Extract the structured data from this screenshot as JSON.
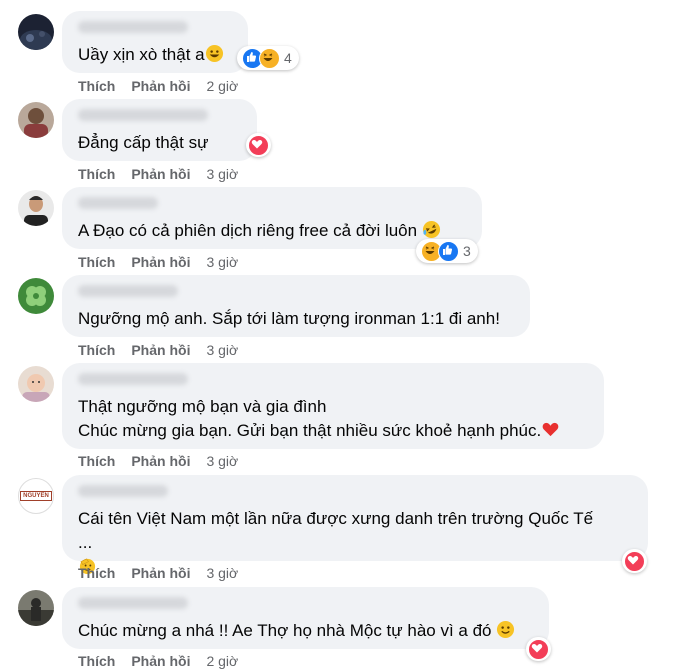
{
  "colors": {
    "bubble": "#f0f2f5",
    "meta": "#65676b",
    "like": "#1877f2",
    "love": "#f33e58",
    "haha": "#f7b125"
  },
  "labels": {
    "like": "Thích",
    "reply": "Phản hồi"
  },
  "comments": [
    {
      "text": "Uầy xịn xò thật a",
      "time": "2 giờ",
      "reactions": [
        "like",
        "haha"
      ],
      "count": "4"
    },
    {
      "text": "Đẳng cấp thật sự",
      "time": "3 giờ",
      "reactions": [
        "love"
      ],
      "count": ""
    },
    {
      "text": "A Đạo có cả phiên dịch riêng free cả đời luôn",
      "time": "3 giờ",
      "reactions": [
        "haha",
        "like"
      ],
      "count": "3"
    },
    {
      "text": "Ngưỡng mộ anh. Sắp tới làm tượng ironman 1:1 đi anh!",
      "time": "3 giờ",
      "reactions": [],
      "count": ""
    },
    {
      "line1": "Thật ngưỡng mộ bạn và gia đình",
      "line2": "Chúc mừng gia bạn. Gửi bạn thật nhiều sức khoẻ hạnh phúc.",
      "time": "3 giờ",
      "reactions": [],
      "count": ""
    },
    {
      "line1": "Cái tên Việt Nam một lần nữa được xưng danh trên trường Quốc Tế",
      "line2": "...",
      "avatar_text": "NGUYÊN",
      "time": "3 giờ",
      "reactions": [
        "love"
      ],
      "count": ""
    },
    {
      "text": "Chúc mừng a nhá !! Ae Thợ họ nhà Mộc tự hào vì a đó",
      "time": "2 giờ",
      "reactions": [
        "love"
      ],
      "count": ""
    }
  ]
}
